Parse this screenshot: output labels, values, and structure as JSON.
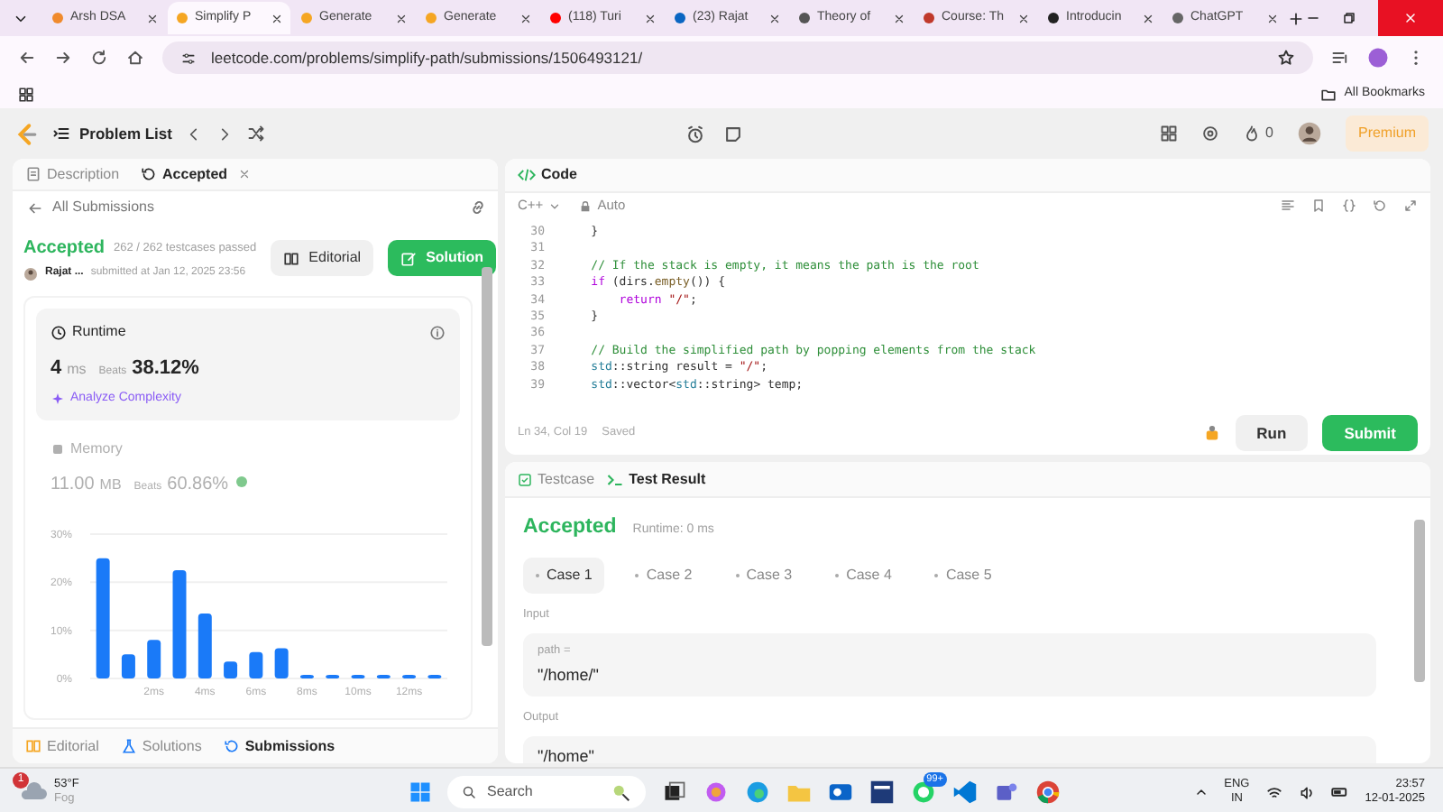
{
  "browser": {
    "tabs": [
      {
        "title": "Arsh DSA",
        "selected": false
      },
      {
        "title": "Simplify P",
        "selected": true
      },
      {
        "title": "Generate",
        "selected": false
      },
      {
        "title": "Generate",
        "selected": false
      },
      {
        "title": "(118) Turi",
        "selected": false
      },
      {
        "title": "(23) Rajat",
        "selected": false
      },
      {
        "title": "Theory of",
        "selected": false
      },
      {
        "title": "Course: Th",
        "selected": false
      },
      {
        "title": "Introducin",
        "selected": false
      },
      {
        "title": "ChatGPT",
        "selected": false
      }
    ],
    "address": "leetcode.com/problems/simplify-path/submissions/1506493121/",
    "bookmarks_label": "All Bookmarks"
  },
  "header": {
    "problem_list": "Problem List",
    "streak": "0",
    "premium": "Premium"
  },
  "left_panel": {
    "tabs": [
      {
        "label": "Description",
        "selected": false,
        "closable": false
      },
      {
        "label": "Accepted",
        "selected": true,
        "closable": true
      }
    ],
    "back_link": "All Submissions",
    "submission": {
      "status": "Accepted",
      "testcases": "262 / 262 testcases passed",
      "author": "Rajat ...",
      "submitted": "submitted at Jan 12, 2025 23:56",
      "buttons": [
        {
          "label": "Editorial",
          "kind": "secondary"
        },
        {
          "label": "Solution",
          "kind": "primary"
        }
      ]
    },
    "runtime": {
      "title": "Runtime",
      "value": "4",
      "unit": "ms",
      "beats_label": "Beats",
      "beats": "38.12%",
      "link": "Analyze Complexity"
    },
    "memory": {
      "title": "Memory",
      "value": "11.00",
      "unit": "MB",
      "beats_label": "Beats",
      "beats": "60.86%"
    },
    "chart_data": {
      "type": "bar",
      "x": [
        0,
        1,
        2,
        3,
        4,
        5,
        6,
        7,
        8,
        9,
        10,
        11,
        12,
        13
      ],
      "xlim": [
        -0.5,
        13.5
      ],
      "series": [
        {
          "color": "#1a7af8",
          "values": [
            25,
            5,
            8,
            22.5,
            13.5,
            3.5,
            5.5,
            6.3,
            0.6,
            0.6,
            0.6,
            0.6,
            0.6,
            0.6
          ]
        }
      ],
      "ylim": [
        0,
        30
      ],
      "yticks": [
        {
          "value": 0,
          "label": "0%"
        },
        {
          "value": 10,
          "label": "10%"
        },
        {
          "value": 20,
          "label": "20%"
        },
        {
          "value": 30,
          "label": "30%"
        }
      ],
      "xticks": [
        {
          "value": 2,
          "label": "2ms"
        },
        {
          "value": 4,
          "label": "4ms"
        },
        {
          "value": 6,
          "label": "6ms"
        },
        {
          "value": 8,
          "label": "8ms"
        },
        {
          "value": 10,
          "label": "10ms"
        },
        {
          "value": 12,
          "label": "12ms"
        }
      ]
    },
    "bottom_tabs": [
      {
        "label": "Editorial",
        "selected": false
      },
      {
        "label": "Solutions",
        "selected": false
      },
      {
        "label": "Submissions",
        "selected": true
      }
    ]
  },
  "code_panel": {
    "title": "Code",
    "language": "C++",
    "mode": "Auto",
    "lines": [
      {
        "number": "30",
        "segments": [
          {
            "text": "    }",
            "kind": "plain"
          }
        ]
      },
      {
        "number": "31"
      },
      {
        "number": "32",
        "segments": [
          {
            "text": "    // If the stack is empty, it means the path is the root",
            "kind": "comment"
          }
        ]
      },
      {
        "number": "33",
        "segments": [
          {
            "text": "    if",
            "kind": "keyword"
          },
          {
            "text": " (dirs.",
            "kind": "plain"
          },
          {
            "text": "empty",
            "kind": "function"
          },
          {
            "text": "()) {",
            "kind": "plain"
          }
        ]
      },
      {
        "number": "34",
        "segments": [
          {
            "text": "        return",
            "kind": "keyword"
          },
          {
            "text": " \"/\"",
            "kind": "string"
          },
          {
            "text": ";",
            "kind": "plain"
          }
        ]
      },
      {
        "number": "35",
        "segments": [
          {
            "text": "    }",
            "kind": "plain"
          }
        ]
      },
      {
        "number": "36"
      },
      {
        "number": "37",
        "segments": [
          {
            "text": "    // Build the simplified path by popping elements from the stack",
            "kind": "comment"
          }
        ]
      },
      {
        "number": "38",
        "segments": [
          {
            "text": "    std",
            "kind": "type"
          },
          {
            "text": "::string result = ",
            "kind": "plain"
          },
          {
            "text": "\"/\"",
            "kind": "string"
          },
          {
            "text": ";",
            "kind": "plain"
          }
        ]
      },
      {
        "number": "39",
        "segments": [
          {
            "text": "    std",
            "kind": "type"
          },
          {
            "text": "::vector<",
            "kind": "plain"
          },
          {
            "text": "std",
            "kind": "type"
          },
          {
            "text": "::string> temp;",
            "kind": "plain"
          }
        ]
      }
    ],
    "cursor": "Ln 34, Col 19",
    "saved": "Saved",
    "buttons": [
      {
        "label": "Run",
        "kind": "secondary"
      },
      {
        "label": "Submit",
        "kind": "primary"
      }
    ]
  },
  "test_panel": {
    "tabs": [
      {
        "label": "Testcase",
        "selected": false
      },
      {
        "label": "Test Result",
        "selected": true
      }
    ],
    "status": "Accepted",
    "runtime": "Runtime: 0 ms",
    "cases": [
      {
        "label": "Case 1",
        "selected": true
      },
      {
        "label": "Case 2",
        "selected": false
      },
      {
        "label": "Case 3",
        "selected": false
      },
      {
        "label": "Case 4",
        "selected": false
      },
      {
        "label": "Case 5",
        "selected": false
      }
    ],
    "input_label": "Input",
    "input_name": "path =",
    "input_value": "\"/home/\"",
    "output_label": "Output",
    "output_value": "\"/home\""
  },
  "taskbar": {
    "weather_badge": "1",
    "temperature": "53°F",
    "weather": "Fog",
    "search_placeholder": "Search",
    "app_badge": "99+",
    "language": "ENG",
    "region": "IN",
    "time": "23:57",
    "date": "12-01-2025"
  }
}
